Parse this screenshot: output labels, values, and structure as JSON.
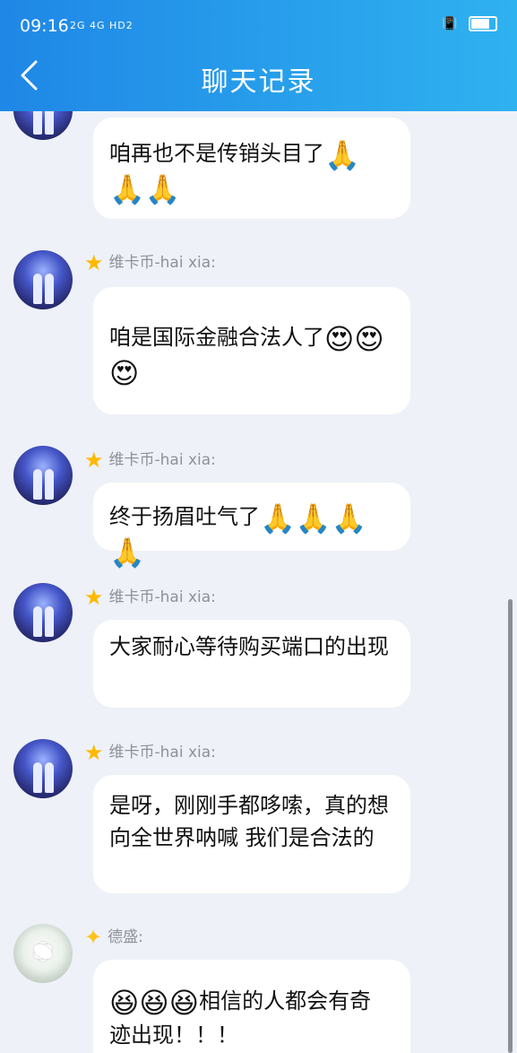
{
  "status": {
    "time": "09:16",
    "network": "2G 4G HD2"
  },
  "header": {
    "title": "聊天记录"
  },
  "messages": [
    {
      "sender": "",
      "text": "咱再也不是传销头目了",
      "emoji": "🙏🙏🙏"
    },
    {
      "sender": "维卡币-hai xia:",
      "text": "咱是国际金融合法人了",
      "emoji": "😍😍😍"
    },
    {
      "sender": "维卡币-hai xia:",
      "text": "终于扬眉吐气了",
      "emoji": "🙏🙏🙏🙏"
    },
    {
      "sender": "维卡币-hai xia:",
      "text": "大家耐心等待购买端口的出现",
      "emoji": ""
    },
    {
      "sender": "维卡币-hai xia:",
      "text": "是呀，刚刚手都哆嗦，真的想向全世界呐喊 我们是合法的",
      "emoji": ""
    },
    {
      "sender": "德盛:",
      "text": "相信的人都会有奇迹出现！！！",
      "emoji": "😆😆😆"
    }
  ],
  "icons": [
    "back-arrow-icon",
    "star-icon",
    "battery-icon",
    "vibrate-icon"
  ]
}
